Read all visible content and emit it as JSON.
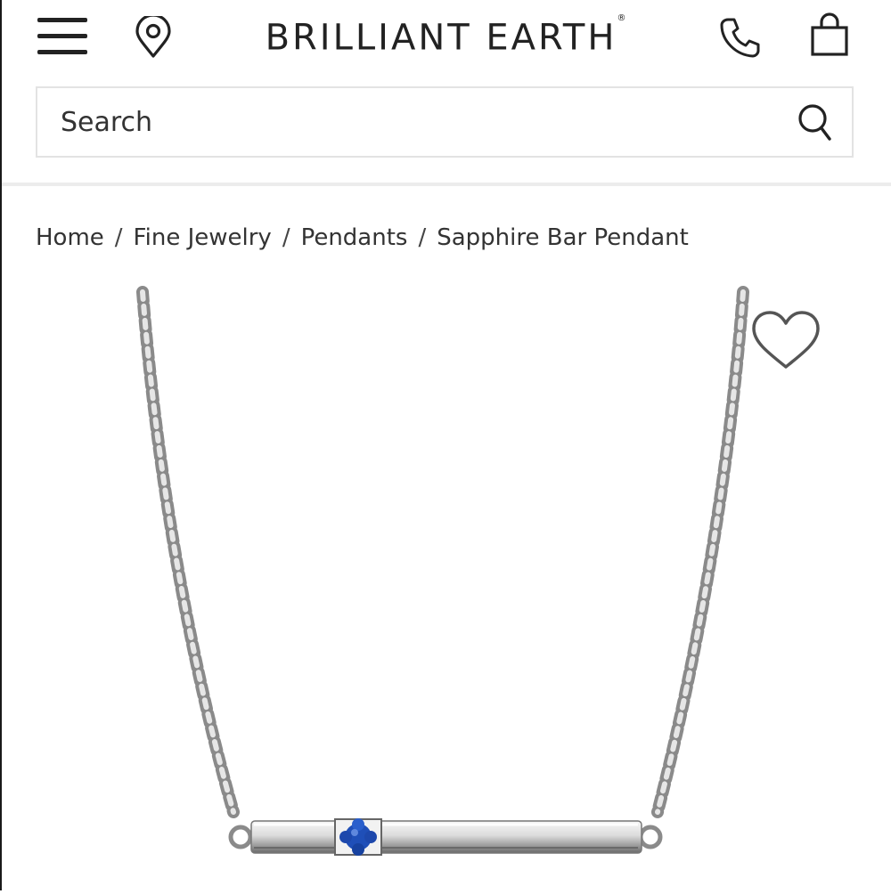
{
  "header": {
    "logo": "BRILLIANT EARTH",
    "logo_mark": "®"
  },
  "icons": {
    "menu": "hamburger-menu-icon",
    "location": "map-pin-icon",
    "phone": "phone-icon",
    "bag": "shopping-bag-icon",
    "search": "search-icon",
    "wishlist": "heart-icon"
  },
  "search": {
    "placeholder": "Search"
  },
  "breadcrumb": {
    "items": [
      "Home",
      "Fine Jewelry",
      "Pendants",
      "Sapphire Bar Pendant"
    ],
    "separator": "/"
  },
  "colors": {
    "text": "#222222",
    "border": "#e3e3e3",
    "sapphire": "#1f4fb8",
    "metal": "#c9c9c9"
  }
}
